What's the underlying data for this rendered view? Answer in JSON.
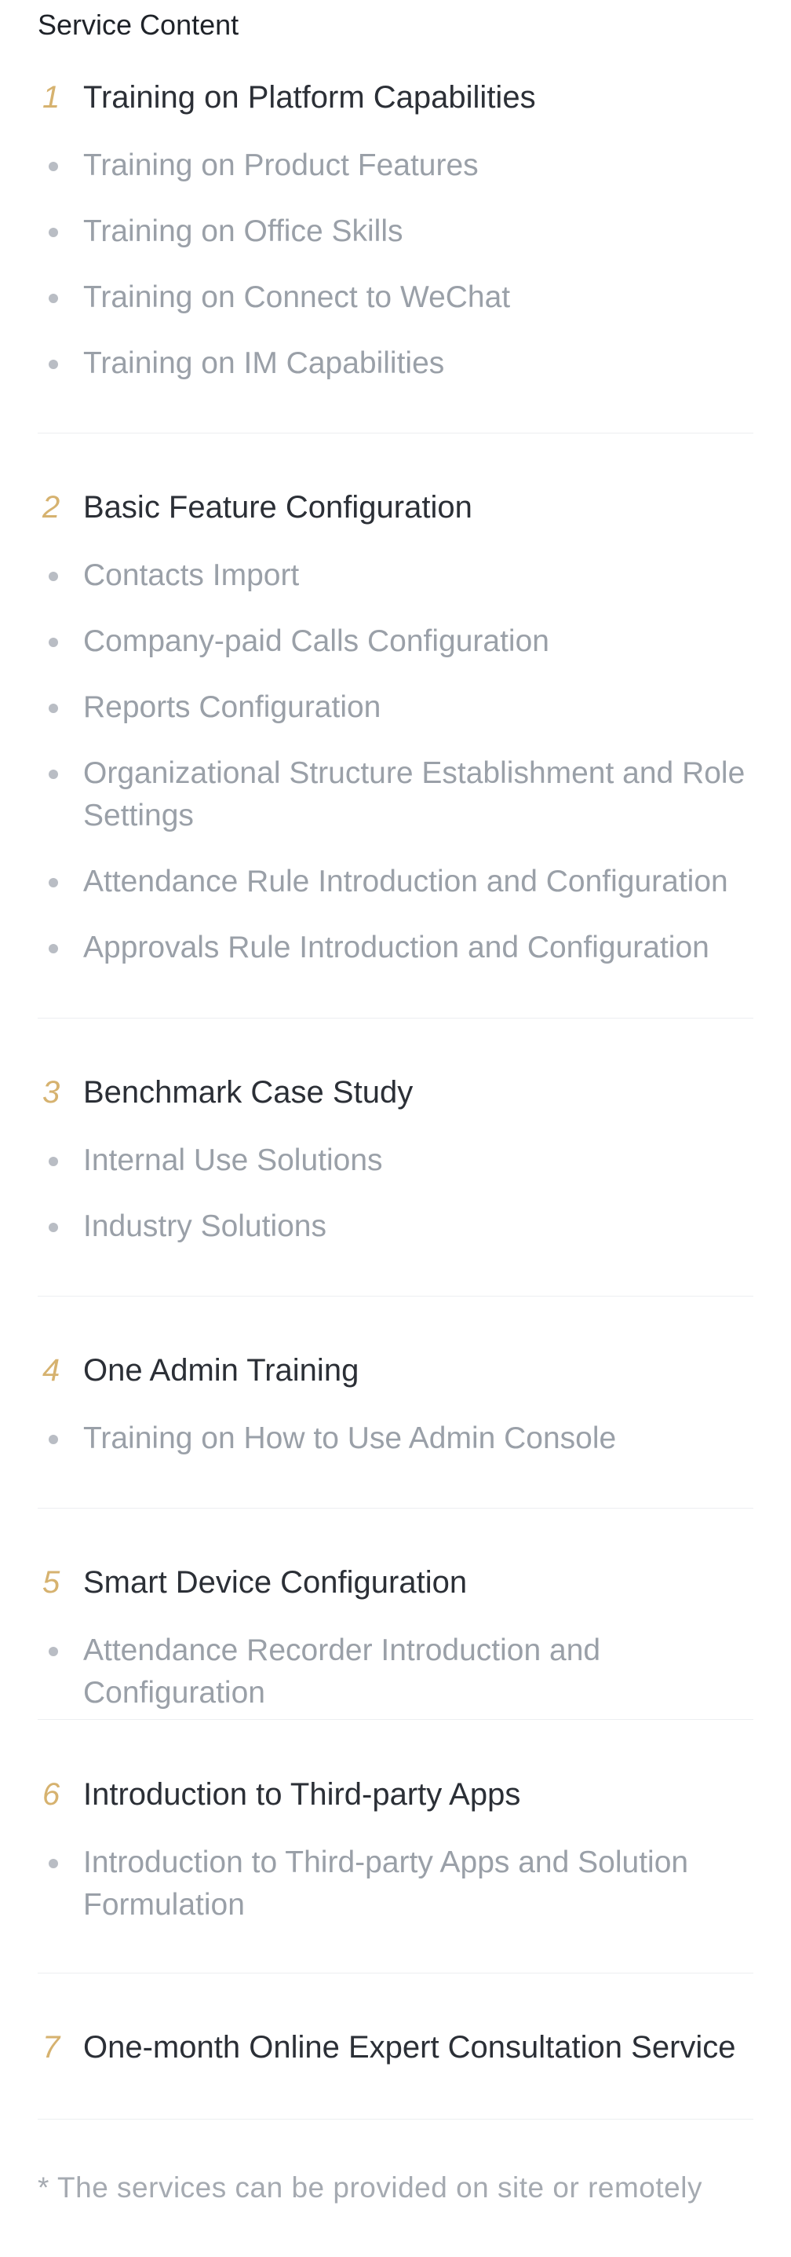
{
  "page_title": "Service Content",
  "sections": [
    {
      "num": "1",
      "title": "Training on Platform Capabilities",
      "items": [
        "Training on Product Features",
        "Training on Office Skills",
        "Training on Connect to WeChat",
        "Training on IM Capabilities"
      ]
    },
    {
      "num": "2",
      "title": "Basic Feature Configuration",
      "items": [
        "Contacts Import",
        "Company-paid Calls Configuration",
        "Reports Configuration",
        "Organizational Structure Establishment and Role Settings",
        "Attendance Rule Introduction and Configuration",
        "Approvals Rule Introduction and Configuration"
      ]
    },
    {
      "num": "3",
      "title": "Benchmark Case Study",
      "items": [
        "Internal Use Solutions",
        "Industry Solutions"
      ]
    },
    {
      "num": "4",
      "title": "One Admin Training",
      "items": [
        "Training on How to Use Admin Console"
      ]
    },
    {
      "num": "5",
      "title": "Smart Device Configuration",
      "items": [
        "Attendance Recorder Introduction and Configuration"
      ]
    },
    {
      "num": "6",
      "title": "Introduction to Third-party Apps",
      "items": [
        "Introduction to Third-party Apps and Solution Formulation"
      ]
    },
    {
      "num": "7",
      "title": "One-month Online Expert Consultation Service",
      "items": []
    }
  ],
  "footnote": "* The services can be provided on site or remotely",
  "colors": {
    "accent_number": "#d6b26f",
    "title_text": "#2b2f36",
    "item_text": "#9aa0a8",
    "bullet": "#b9bdc4",
    "divider": "#eceef1"
  }
}
